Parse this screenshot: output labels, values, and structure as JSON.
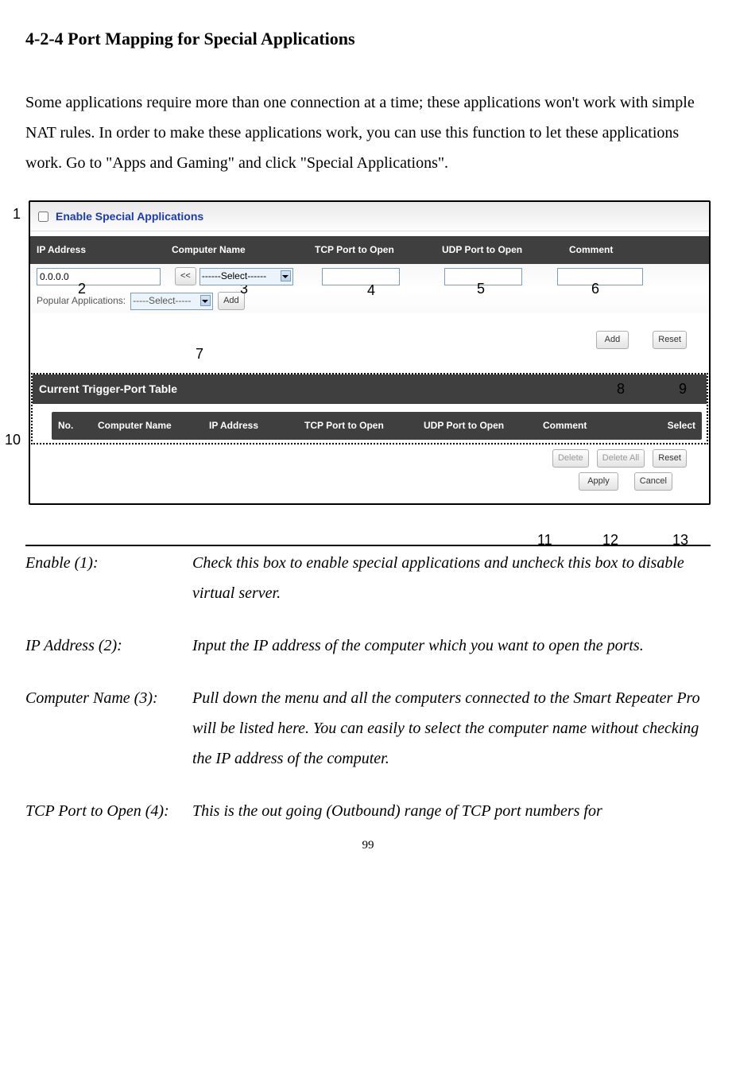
{
  "heading": "4-2-4 Port Mapping for Special Applications",
  "intro": "Some applications require more than one connection at a time; these applications won't work with simple NAT rules. In order to make these applications work, you can use this function to let these applications work. Go to \"Apps and Gaming\" and click \"Special Applications\".",
  "markers": {
    "m1": "1",
    "m2": "2",
    "m3": "3",
    "m4": "4",
    "m5": "5",
    "m6": "6",
    "m7": "7",
    "m8": "8",
    "m9": "9",
    "m10": "10",
    "m11": "11",
    "m12": "12",
    "m13": "13"
  },
  "ui": {
    "enable_label": "Enable Special Applications",
    "cols": {
      "ip": "IP Address",
      "cname": "Computer Name",
      "tcp": "TCP Port to Open",
      "udp": "UDP Port to Open",
      "comment": "Comment"
    },
    "ip_value": "0.0.0.0",
    "guillemet": "<<",
    "select_text": "------Select------",
    "pop_label": "Popular Applications:",
    "pop_select": "-----Select-----",
    "btn_add_small": "Add",
    "btn_add": "Add",
    "btn_reset": "Reset",
    "section2": "Current Trigger-Port Table",
    "tcols": {
      "no": "No.",
      "cname": "Computer Name",
      "ip": "IP Address",
      "tcp": "TCP Port to Open",
      "udp": "UDP Port to Open",
      "comment": "Comment",
      "select": "Select"
    },
    "btn_delete": "Delete",
    "btn_delete_all": "Delete All",
    "btn_reset2": "Reset",
    "btn_apply": "Apply",
    "btn_cancel": "Cancel"
  },
  "defs": {
    "d1_term": "Enable (1):",
    "d1_body": "Check this box to enable special applications and uncheck this box to disable virtual server.",
    "d2_term": "IP Address (2):",
    "d2_body": "Input the IP address of the computer which you want to open the ports.",
    "d3_term": "Computer Name (3):",
    "d3_body": "Pull down the menu and all the computers connected to the Smart Repeater Pro will be listed here. You can easily to select the computer name without checking the IP address of the computer.",
    "d4_term": "TCP Port to Open (4):",
    "d4_body": "This is the out going (Outbound) range of TCP port numbers for"
  },
  "page_number": "99"
}
